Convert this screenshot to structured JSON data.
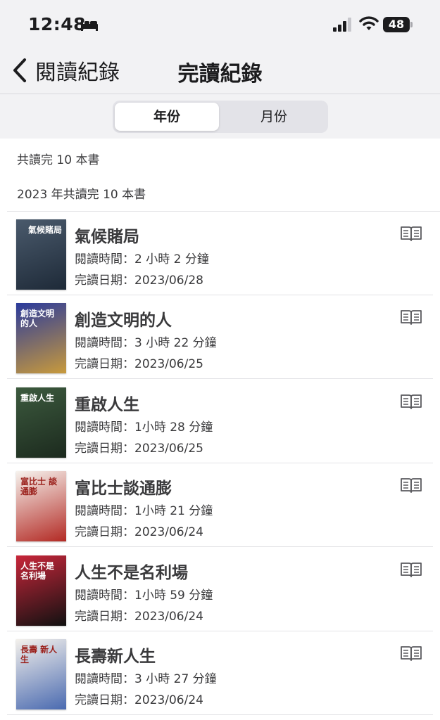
{
  "status_bar": {
    "time": "12:48",
    "battery": "48"
  },
  "nav": {
    "back_label": "閱讀紀錄",
    "title": "完讀紀錄"
  },
  "segments": [
    "年份",
    "月份"
  ],
  "summary": "共讀完 10 本書",
  "year_summary": "2023 年共讀完 10 本書",
  "books": [
    {
      "title": "氣候賭局",
      "reading_time": "閱讀時間：2 小時 2 分鐘",
      "finished": "完讀日期：2023/06/28",
      "cover_text": "氣候賭局",
      "cover_colors": [
        "#4a5a6c",
        "#1e2a38"
      ]
    },
    {
      "title": "創造文明的人",
      "reading_time": "閱讀時間：3 小時 22 分鐘",
      "finished": "完讀日期：2023/06/25",
      "cover_text": "創造文明的人",
      "cover_colors": [
        "#2a3a9c",
        "#c89a3c"
      ]
    },
    {
      "title": "重啟人生",
      "reading_time": "閱讀時間：1小時 28 分鐘",
      "finished": "完讀日期：2023/06/25",
      "cover_text": "重啟人生",
      "cover_colors": [
        "#3c5a3e",
        "#1c2a1e"
      ]
    },
    {
      "title": "富比士談通膨",
      "reading_time": "閱讀時間：1小時 21 分鐘",
      "finished": "完讀日期：2023/06/24",
      "cover_text": "富比士 談通膨",
      "cover_colors": [
        "#f6f3ee",
        "#b32a24"
      ]
    },
    {
      "title": "人生不是名利場",
      "reading_time": "閱讀時間：1小時 59 分鐘",
      "finished": "完讀日期：2023/06/24",
      "cover_text": "人生不是名利場",
      "cover_colors": [
        "#c8263a",
        "#111111"
      ]
    },
    {
      "title": "長壽新人生",
      "reading_time": "閱讀時間：3 小時 27 分鐘",
      "finished": "完讀日期：2023/06/24",
      "cover_text": "長壽 新人生",
      "cover_colors": [
        "#f4f1ec",
        "#4a6ab0"
      ]
    }
  ]
}
